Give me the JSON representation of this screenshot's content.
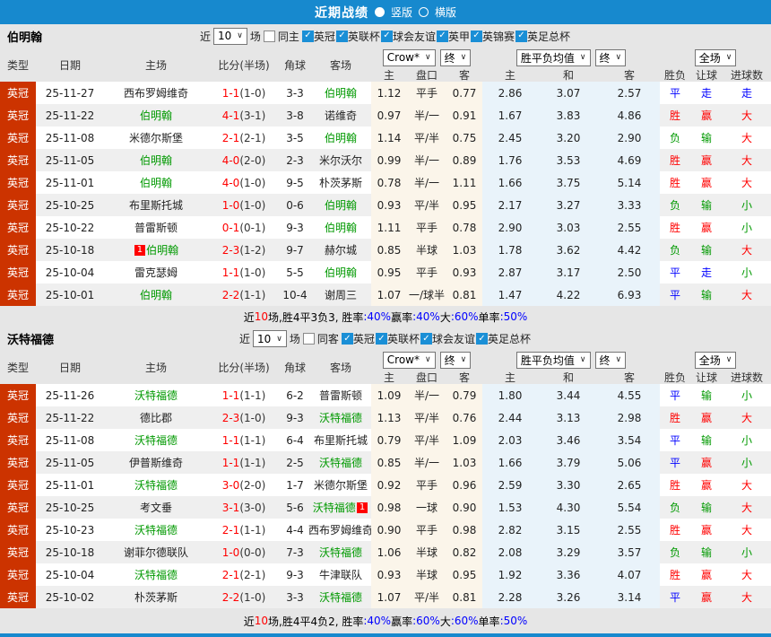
{
  "topbar": {
    "title": "近期战绩",
    "layout_options": [
      {
        "label": "竖版",
        "selected": true
      },
      {
        "label": "横版",
        "selected": false
      }
    ]
  },
  "colors": {
    "accent_blue": "#1789ce",
    "type_badge": "#cc3300",
    "win_red": "#ff0000",
    "draw_blue": "#0000ff",
    "lose_green": "#009900"
  },
  "table": {
    "headers": {
      "type": "类型",
      "date": "日期",
      "home": "主场",
      "score": "比分(半场)",
      "corner": "角球",
      "away": "客场"
    },
    "sub_headers": {
      "ah_home": "主",
      "ah_line": "盘口",
      "ah_away": "客",
      "eu_home": "主",
      "eu_draw": "和",
      "eu_away": "客",
      "result": "胜负",
      "handicap": "让球",
      "goals": "进球数"
    },
    "selects": {
      "odds_source": "Crow*",
      "odds_final": "终",
      "avg": "胜平负均值",
      "avg_final": "终",
      "scope": "全场"
    }
  },
  "sections": [
    {
      "team": "伯明翰",
      "filter": {
        "near": "近",
        "count": "10",
        "unit": "场",
        "same": {
          "label": "同主",
          "checked": false
        },
        "leagues": [
          {
            "label": "英冠",
            "checked": true
          },
          {
            "label": "英联杯",
            "checked": true
          },
          {
            "label": "球会友谊",
            "checked": true
          },
          {
            "label": "英甲",
            "checked": true
          },
          {
            "label": "英锦赛",
            "checked": true
          },
          {
            "label": "英足总杯",
            "checked": true
          }
        ]
      },
      "rows": [
        {
          "type": "英冠",
          "date": "25-11-27",
          "home": {
            "t": "西布罗姆维奇"
          },
          "home_card": "",
          "score": "1-1",
          "half": "(1-0)",
          "corner": "3-3",
          "away": {
            "t": "伯明翰",
            "c": "green"
          },
          "away_card": "",
          "ah_home": "1.12",
          "ah_line": "平手",
          "ah_away": "0.77",
          "eu_home": "2.86",
          "eu_draw": "3.07",
          "eu_away": "2.57",
          "result": {
            "t": "平",
            "c": "blue"
          },
          "handicap": {
            "t": "走",
            "c": "blue"
          },
          "goals": {
            "t": "走",
            "c": "blue"
          }
        },
        {
          "type": "英冠",
          "date": "25-11-22",
          "home": {
            "t": "伯明翰",
            "c": "green"
          },
          "home_card": "",
          "score": "4-1",
          "half": "(3-1)",
          "corner": "3-8",
          "away": {
            "t": "诺维奇"
          },
          "away_card": "",
          "ah_home": "0.97",
          "ah_line": "半/一",
          "ah_away": "0.91",
          "eu_home": "1.67",
          "eu_draw": "3.83",
          "eu_away": "4.86",
          "result": {
            "t": "胜",
            "c": "red"
          },
          "handicap": {
            "t": "赢",
            "c": "red"
          },
          "goals": {
            "t": "大",
            "c": "red"
          }
        },
        {
          "type": "英冠",
          "date": "25-11-08",
          "home": {
            "t": "米德尔斯堡"
          },
          "home_card": "",
          "score": "2-1",
          "half": "(2-1)",
          "corner": "3-5",
          "away": {
            "t": "伯明翰",
            "c": "green"
          },
          "away_card": "",
          "ah_home": "1.14",
          "ah_line": "平/半",
          "ah_away": "0.75",
          "eu_home": "2.45",
          "eu_draw": "3.20",
          "eu_away": "2.90",
          "result": {
            "t": "负",
            "c": "green"
          },
          "handicap": {
            "t": "输",
            "c": "green"
          },
          "goals": {
            "t": "大",
            "c": "red"
          }
        },
        {
          "type": "英冠",
          "date": "25-11-05",
          "home": {
            "t": "伯明翰",
            "c": "green"
          },
          "home_card": "",
          "score": "4-0",
          "half": "(2-0)",
          "corner": "2-3",
          "away": {
            "t": "米尔沃尔"
          },
          "away_card": "",
          "ah_home": "0.99",
          "ah_line": "半/一",
          "ah_away": "0.89",
          "eu_home": "1.76",
          "eu_draw": "3.53",
          "eu_away": "4.69",
          "result": {
            "t": "胜",
            "c": "red"
          },
          "handicap": {
            "t": "赢",
            "c": "red"
          },
          "goals": {
            "t": "大",
            "c": "red"
          }
        },
        {
          "type": "英冠",
          "date": "25-11-01",
          "home": {
            "t": "伯明翰",
            "c": "green"
          },
          "home_card": "",
          "score": "4-0",
          "half": "(1-0)",
          "corner": "9-5",
          "away": {
            "t": "朴茨茅斯"
          },
          "away_card": "",
          "ah_home": "0.78",
          "ah_line": "半/一",
          "ah_away": "1.11",
          "eu_home": "1.66",
          "eu_draw": "3.75",
          "eu_away": "5.14",
          "result": {
            "t": "胜",
            "c": "red"
          },
          "handicap": {
            "t": "赢",
            "c": "red"
          },
          "goals": {
            "t": "大",
            "c": "red"
          }
        },
        {
          "type": "英冠",
          "date": "25-10-25",
          "home": {
            "t": "布里斯托城"
          },
          "home_card": "",
          "score": "1-0",
          "half": "(1-0)",
          "corner": "0-6",
          "away": {
            "t": "伯明翰",
            "c": "green"
          },
          "away_card": "",
          "ah_home": "0.93",
          "ah_line": "平/半",
          "ah_away": "0.95",
          "eu_home": "2.17",
          "eu_draw": "3.27",
          "eu_away": "3.33",
          "result": {
            "t": "负",
            "c": "green"
          },
          "handicap": {
            "t": "输",
            "c": "green"
          },
          "goals": {
            "t": "小",
            "c": "green"
          }
        },
        {
          "type": "英冠",
          "date": "25-10-22",
          "home": {
            "t": "普雷斯顿"
          },
          "home_card": "",
          "score": "0-1",
          "half": "(0-1)",
          "corner": "9-3",
          "away": {
            "t": "伯明翰",
            "c": "green"
          },
          "away_card": "",
          "ah_home": "1.11",
          "ah_line": "平手",
          "ah_away": "0.78",
          "eu_home": "2.90",
          "eu_draw": "3.03",
          "eu_away": "2.55",
          "result": {
            "t": "胜",
            "c": "red"
          },
          "handicap": {
            "t": "赢",
            "c": "red"
          },
          "goals": {
            "t": "小",
            "c": "green"
          }
        },
        {
          "type": "英冠",
          "date": "25-10-18",
          "home": {
            "t": "伯明翰",
            "c": "green"
          },
          "home_card": "1",
          "score": "2-3",
          "half": "(1-2)",
          "corner": "9-7",
          "away": {
            "t": "赫尔城"
          },
          "away_card": "",
          "ah_home": "0.85",
          "ah_line": "半球",
          "ah_away": "1.03",
          "eu_home": "1.78",
          "eu_draw": "3.62",
          "eu_away": "4.42",
          "result": {
            "t": "负",
            "c": "green"
          },
          "handicap": {
            "t": "输",
            "c": "green"
          },
          "goals": {
            "t": "大",
            "c": "red"
          }
        },
        {
          "type": "英冠",
          "date": "25-10-04",
          "home": {
            "t": "雷克瑟姆"
          },
          "home_card": "",
          "score": "1-1",
          "half": "(1-0)",
          "corner": "5-5",
          "away": {
            "t": "伯明翰",
            "c": "green"
          },
          "away_card": "",
          "ah_home": "0.95",
          "ah_line": "平手",
          "ah_away": "0.93",
          "eu_home": "2.87",
          "eu_draw": "3.17",
          "eu_away": "2.50",
          "result": {
            "t": "平",
            "c": "blue"
          },
          "handicap": {
            "t": "走",
            "c": "blue"
          },
          "goals": {
            "t": "小",
            "c": "green"
          }
        },
        {
          "type": "英冠",
          "date": "25-10-01",
          "home": {
            "t": "伯明翰",
            "c": "green"
          },
          "home_card": "",
          "score": "2-2",
          "half": "(1-1)",
          "corner": "10-4",
          "away": {
            "t": "谢周三"
          },
          "away_card": "",
          "ah_home": "1.07",
          "ah_line": "一/球半",
          "ah_away": "0.81",
          "eu_home": "1.47",
          "eu_draw": "4.22",
          "eu_away": "6.93",
          "result": {
            "t": "平",
            "c": "blue"
          },
          "handicap": {
            "t": "输",
            "c": "green"
          },
          "goals": {
            "t": "大",
            "c": "red"
          }
        }
      ],
      "summary": [
        {
          "t": "近",
          "c": "k"
        },
        {
          "t": "10",
          "c": "r"
        },
        {
          "t": "场,胜4平3负3, 胜率",
          "c": "k"
        },
        {
          "t": ":40%",
          "c": "b"
        },
        {
          "t": " 赢率",
          "c": "k"
        },
        {
          "t": ":40%",
          "c": "b"
        },
        {
          "t": " 大",
          "c": "k"
        },
        {
          "t": ":60%",
          "c": "b"
        },
        {
          "t": " 单率",
          "c": "k"
        },
        {
          "t": ":50%",
          "c": "b"
        }
      ]
    },
    {
      "team": "沃特福德",
      "filter": {
        "near": "近",
        "count": "10",
        "unit": "场",
        "same": {
          "label": "同客",
          "checked": false
        },
        "leagues": [
          {
            "label": "英冠",
            "checked": true
          },
          {
            "label": "英联杯",
            "checked": true
          },
          {
            "label": "球会友谊",
            "checked": true
          },
          {
            "label": "英足总杯",
            "checked": true
          }
        ]
      },
      "rows": [
        {
          "type": "英冠",
          "date": "25-11-26",
          "home": {
            "t": "沃特福德",
            "c": "green"
          },
          "home_card": "",
          "score": "1-1",
          "half": "(1-1)",
          "corner": "6-2",
          "away": {
            "t": "普雷斯顿"
          },
          "away_card": "",
          "ah_home": "1.09",
          "ah_line": "半/一",
          "ah_away": "0.79",
          "eu_home": "1.80",
          "eu_draw": "3.44",
          "eu_away": "4.55",
          "result": {
            "t": "平",
            "c": "blue"
          },
          "handicap": {
            "t": "输",
            "c": "green"
          },
          "goals": {
            "t": "小",
            "c": "green"
          }
        },
        {
          "type": "英冠",
          "date": "25-11-22",
          "home": {
            "t": "德比郡"
          },
          "home_card": "",
          "score": "2-3",
          "half": "(1-0)",
          "corner": "9-3",
          "away": {
            "t": "沃特福德",
            "c": "green"
          },
          "away_card": "",
          "ah_home": "1.13",
          "ah_line": "平/半",
          "ah_away": "0.76",
          "eu_home": "2.44",
          "eu_draw": "3.13",
          "eu_away": "2.98",
          "result": {
            "t": "胜",
            "c": "red"
          },
          "handicap": {
            "t": "赢",
            "c": "red"
          },
          "goals": {
            "t": "大",
            "c": "red"
          }
        },
        {
          "type": "英冠",
          "date": "25-11-08",
          "home": {
            "t": "沃特福德",
            "c": "green"
          },
          "home_card": "",
          "score": "1-1",
          "half": "(1-1)",
          "corner": "6-4",
          "away": {
            "t": "布里斯托城"
          },
          "away_card": "",
          "ah_home": "0.79",
          "ah_line": "平/半",
          "ah_away": "1.09",
          "eu_home": "2.03",
          "eu_draw": "3.46",
          "eu_away": "3.54",
          "result": {
            "t": "平",
            "c": "blue"
          },
          "handicap": {
            "t": "输",
            "c": "green"
          },
          "goals": {
            "t": "小",
            "c": "green"
          }
        },
        {
          "type": "英冠",
          "date": "25-11-05",
          "home": {
            "t": "伊普斯维奇"
          },
          "home_card": "",
          "score": "1-1",
          "half": "(1-1)",
          "corner": "2-5",
          "away": {
            "t": "沃特福德",
            "c": "green"
          },
          "away_card": "",
          "ah_home": "0.85",
          "ah_line": "半/一",
          "ah_away": "1.03",
          "eu_home": "1.66",
          "eu_draw": "3.79",
          "eu_away": "5.06",
          "result": {
            "t": "平",
            "c": "blue"
          },
          "handicap": {
            "t": "赢",
            "c": "red"
          },
          "goals": {
            "t": "小",
            "c": "green"
          }
        },
        {
          "type": "英冠",
          "date": "25-11-01",
          "home": {
            "t": "沃特福德",
            "c": "green"
          },
          "home_card": "",
          "score": "3-0",
          "half": "(2-0)",
          "corner": "1-7",
          "away": {
            "t": "米德尔斯堡"
          },
          "away_card": "",
          "ah_home": "0.92",
          "ah_line": "平手",
          "ah_away": "0.96",
          "eu_home": "2.59",
          "eu_draw": "3.30",
          "eu_away": "2.65",
          "result": {
            "t": "胜",
            "c": "red"
          },
          "handicap": {
            "t": "赢",
            "c": "red"
          },
          "goals": {
            "t": "大",
            "c": "red"
          }
        },
        {
          "type": "英冠",
          "date": "25-10-25",
          "home": {
            "t": "考文垂"
          },
          "home_card": "",
          "score": "3-1",
          "half": "(3-0)",
          "corner": "5-6",
          "away": {
            "t": "沃特福德",
            "c": "green"
          },
          "away_card": "1",
          "ah_home": "0.98",
          "ah_line": "一球",
          "ah_away": "0.90",
          "eu_home": "1.53",
          "eu_draw": "4.30",
          "eu_away": "5.54",
          "result": {
            "t": "负",
            "c": "green"
          },
          "handicap": {
            "t": "输",
            "c": "green"
          },
          "goals": {
            "t": "大",
            "c": "red"
          }
        },
        {
          "type": "英冠",
          "date": "25-10-23",
          "home": {
            "t": "沃特福德",
            "c": "green"
          },
          "home_card": "",
          "score": "2-1",
          "half": "(1-1)",
          "corner": "4-4",
          "away": {
            "t": "西布罗姆维奇"
          },
          "away_card": "",
          "ah_home": "0.90",
          "ah_line": "平手",
          "ah_away": "0.98",
          "eu_home": "2.82",
          "eu_draw": "3.15",
          "eu_away": "2.55",
          "result": {
            "t": "胜",
            "c": "red"
          },
          "handicap": {
            "t": "赢",
            "c": "red"
          },
          "goals": {
            "t": "大",
            "c": "red"
          }
        },
        {
          "type": "英冠",
          "date": "25-10-18",
          "home": {
            "t": "谢菲尔德联队"
          },
          "home_card": "",
          "score": "1-0",
          "half": "(0-0)",
          "corner": "7-3",
          "away": {
            "t": "沃特福德",
            "c": "green"
          },
          "away_card": "",
          "ah_home": "1.06",
          "ah_line": "半球",
          "ah_away": "0.82",
          "eu_home": "2.08",
          "eu_draw": "3.29",
          "eu_away": "3.57",
          "result": {
            "t": "负",
            "c": "green"
          },
          "handicap": {
            "t": "输",
            "c": "green"
          },
          "goals": {
            "t": "小",
            "c": "green"
          }
        },
        {
          "type": "英冠",
          "date": "25-10-04",
          "home": {
            "t": "沃特福德",
            "c": "green"
          },
          "home_card": "",
          "score": "2-1",
          "half": "(2-1)",
          "corner": "9-3",
          "away": {
            "t": "牛津联队"
          },
          "away_card": "",
          "ah_home": "0.93",
          "ah_line": "半球",
          "ah_away": "0.95",
          "eu_home": "1.92",
          "eu_draw": "3.36",
          "eu_away": "4.07",
          "result": {
            "t": "胜",
            "c": "red"
          },
          "handicap": {
            "t": "赢",
            "c": "red"
          },
          "goals": {
            "t": "大",
            "c": "red"
          }
        },
        {
          "type": "英冠",
          "date": "25-10-02",
          "home": {
            "t": "朴茨茅斯"
          },
          "home_card": "",
          "score": "2-2",
          "half": "(1-0)",
          "corner": "3-3",
          "away": {
            "t": "沃特福德",
            "c": "green"
          },
          "away_card": "",
          "ah_home": "1.07",
          "ah_line": "平/半",
          "ah_away": "0.81",
          "eu_home": "2.28",
          "eu_draw": "3.26",
          "eu_away": "3.14",
          "result": {
            "t": "平",
            "c": "blue"
          },
          "handicap": {
            "t": "赢",
            "c": "red"
          },
          "goals": {
            "t": "大",
            "c": "red"
          }
        }
      ],
      "summary": [
        {
          "t": "近",
          "c": "k"
        },
        {
          "t": "10",
          "c": "r"
        },
        {
          "t": "场,胜4平4负2, 胜率",
          "c": "k"
        },
        {
          "t": ":40%",
          "c": "b"
        },
        {
          "t": " 赢率",
          "c": "k"
        },
        {
          "t": ":60%",
          "c": "b"
        },
        {
          "t": " 大",
          "c": "k"
        },
        {
          "t": ":60%",
          "c": "b"
        },
        {
          "t": " 单率",
          "c": "k"
        },
        {
          "t": ":50%",
          "c": "b"
        }
      ]
    }
  ]
}
